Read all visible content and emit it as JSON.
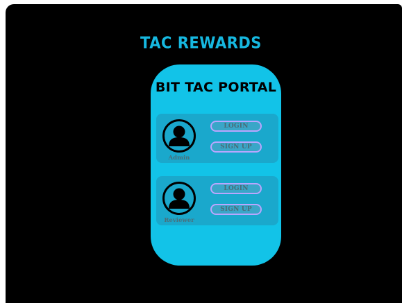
{
  "app": {
    "title": "TAC REWARDS"
  },
  "portal": {
    "title": "BIT TAC PORTAL",
    "roles": [
      {
        "label": "Admin",
        "login_label": "LOGIN",
        "signup_label": "SIGN UP",
        "avatar_icon": "user-avatar-icon"
      },
      {
        "label": "Reviewer",
        "login_label": "LOGIN",
        "signup_label": "SIGN UP",
        "avatar_icon": "user-avatar-icon"
      }
    ]
  },
  "colors": {
    "background": "#000000",
    "accent": "#12c3e8",
    "title_text": "#16b8e0",
    "panel": "#1aa8cc",
    "button_fill": "#3aa6c8",
    "button_border": "#b9a6ff",
    "role_text": "#4b6f7a",
    "button_text": "#4a6b78",
    "avatar": "#000000"
  }
}
